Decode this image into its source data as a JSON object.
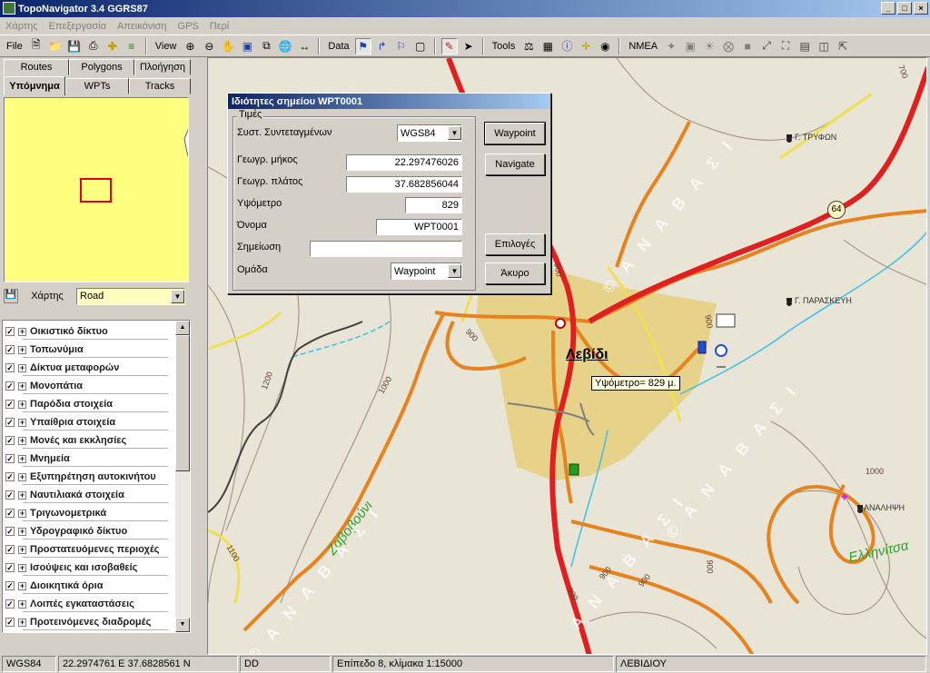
{
  "window": {
    "title": "TopoNavigator 3.4 GGRS87",
    "min": "_",
    "max": "□",
    "close": "×"
  },
  "menu": [
    "Χάρτης",
    "Επεξεργασία",
    "Απεικόνιση",
    "GPS",
    "Περί"
  ],
  "toolbar": {
    "file": "File",
    "view": "View",
    "data": "Data",
    "tools": "Tools",
    "nmea": "NMEA"
  },
  "left": {
    "tabs_top": [
      "Routes",
      "Polygons",
      "Πλοήγηση"
    ],
    "tabs_bottom": [
      "Υπόμνημα",
      "WPTs",
      "Tracks"
    ],
    "map_label": "Χάρτης",
    "map_value": "Road",
    "layers": [
      "Οικιστικό δίκτυο",
      "Τοπωνύμια",
      "Δίκτυα μεταφορών",
      "Μονοπάτια",
      "Παρόδια στοιχεία",
      "Υπαίθρια στοιχεία",
      "Μονές και εκκλησίες",
      "Μνημεία",
      "Εξυπηρέτηση αυτοκινήτου",
      "Ναυτιλιακά στοιχεία",
      "Τριγωνομετρικά",
      "Υδρογραφικό δίκτυο",
      "Προστατευόμενες περιοχές",
      "Ισούψεις και ισοβαθείς",
      "Διοικητικά όρια",
      "Λοιπές εγκαταστάσεις",
      "Προτεινόμενες διαδρομές"
    ]
  },
  "dialog": {
    "title": "Ιδιότητες σημείου WPT0001",
    "group": "Τιμές",
    "coord_label": "Συστ. Συντεταγμένων",
    "coord_value": "WGS84",
    "lon_label": "Γεωγρ. μήκος",
    "lon_value": "22.297476026",
    "lat_label": "Γεωγρ. πλάτος",
    "lat_value": "37.682856044",
    "alt_label": "Υψόμετρο",
    "alt_value": "829",
    "name_label": "Όνομα",
    "name_value": "WPT0001",
    "note_label": "Σημείωση",
    "note_value": "",
    "group_label": "Ομάδα",
    "group_value": "Waypoint",
    "btn_waypoint": "Waypoint",
    "btn_navigate": "Navigate",
    "btn_options": "Επιλογές",
    "btn_cancel": "Άκυρο"
  },
  "map": {
    "town": "Λεβίδι",
    "tooltip": "Υψόμετρο= 829 μ.",
    "poi_tryfon": "Γ. ΤΡΥΦΩΝ",
    "poi_paraskevi": "Γ. ΠΑΡΑΣΚΕΥΗ",
    "poi_analipsi": "ΑΝΑΛΗΨΗ",
    "area_zavovouni": "Ζαβοβούνι",
    "area_ellinitsa": "Ελληνίτσα",
    "anavasi": "© Α Ν Α Β Α Σ Ι",
    "anavasi_short": "Α Ν Α Β Α Σ Ι",
    "road_num": "64",
    "contours": [
      "700",
      "900",
      "900",
      "900",
      "900",
      "1200",
      "1000",
      "1100",
      "900",
      "900",
      "1000",
      "900"
    ]
  },
  "status": {
    "datum": "WGS84",
    "coords": "22.2974761 E  37.6828561 N",
    "format": "DD",
    "level": "Επίπεδο 8, κλίμακα 1:15000",
    "place": "ΛΕΒΙΔΙΟΥ"
  }
}
